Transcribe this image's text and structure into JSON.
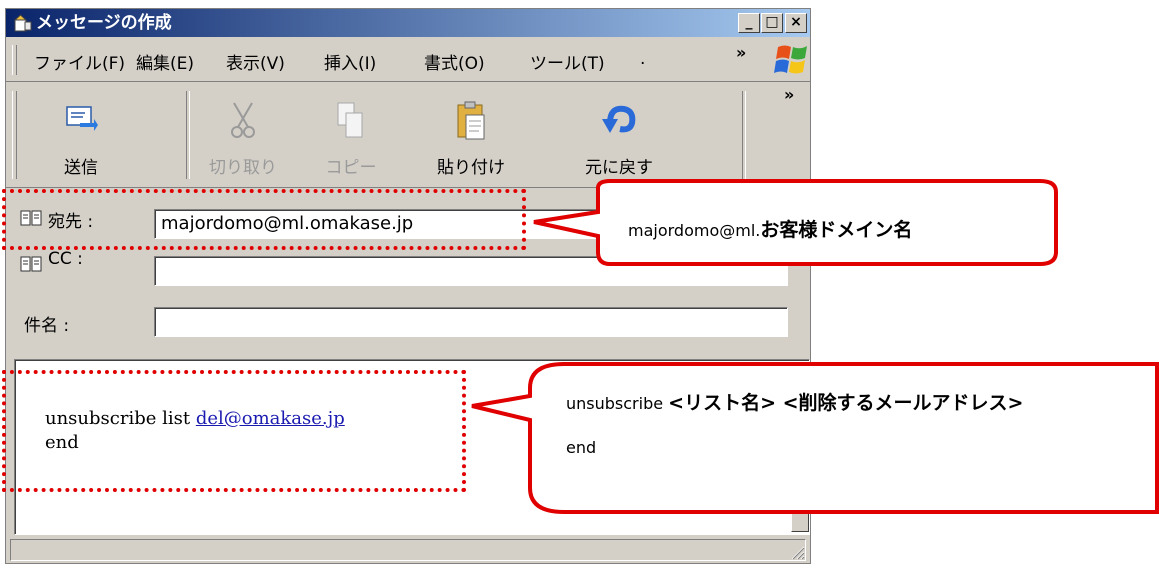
{
  "window": {
    "title": "メッセージの作成",
    "controls": {
      "minimize": "_",
      "maximize": "□",
      "close": "×"
    }
  },
  "menu": {
    "items": [
      "ファイル(F)",
      "編集(E)",
      "表示(V)",
      "挿入(I)",
      "書式(O)",
      "ツール(T)"
    ],
    "overflow": "»",
    "trailing": "."
  },
  "toolbar": {
    "buttons": [
      {
        "label": "送信",
        "icon": "send-icon",
        "enabled": true
      },
      {
        "label": "切り取り",
        "icon": "scissors-icon",
        "enabled": false
      },
      {
        "label": "コピー",
        "icon": "copy-icon",
        "enabled": false
      },
      {
        "label": "貼り付け",
        "icon": "paste-icon",
        "enabled": true
      },
      {
        "label": "元に戻す",
        "icon": "undo-icon",
        "enabled": true
      }
    ],
    "overflow": "»"
  },
  "fields": {
    "to_label": "宛先 :",
    "to_value": "majordomo@ml.omakase.jp",
    "cc_label": "CC :",
    "cc_value": "",
    "subject_label": "件名 :",
    "subject_value": ""
  },
  "body": {
    "line1_prefix": "unsubscribe list ",
    "line1_link": "del@omakase.jp",
    "line2": "end"
  },
  "callouts": {
    "to": {
      "prefix": "majordomo@ml.",
      "bold": "お客様ドメイン名"
    },
    "body": {
      "line1_prefix": "unsubscribe ",
      "line1_bold": "<リスト名> <削除するメールアドレス>",
      "line2": "end"
    }
  },
  "colors": {
    "annotation": "#e00000",
    "titlebar_start": "#0a246a",
    "titlebar_end": "#a6caf0",
    "link": "#1a1ab0"
  }
}
